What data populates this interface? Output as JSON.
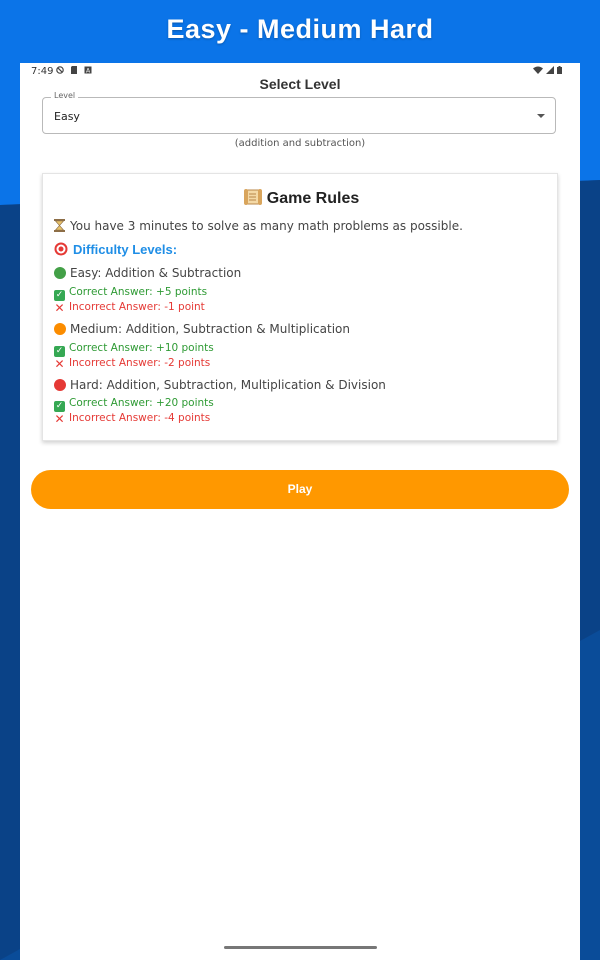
{
  "banner": {
    "title": "Easy - Medium Hard"
  },
  "status_bar": {
    "time": "7:49"
  },
  "page": {
    "heading": "Select Level"
  },
  "level_select": {
    "label": "Level",
    "value": "Easy",
    "helper": "(addition and subtraction)"
  },
  "rules": {
    "title": "Game Rules",
    "timer_text": "You have 3 minutes to solve as many math problems as possible.",
    "difficulty_heading": "Difficulty Levels:",
    "levels": [
      {
        "name": "Easy: Addition & Subtraction",
        "correct": "Correct Answer: +5 points",
        "incorrect": "Incorrect Answer: -1 point"
      },
      {
        "name": "Medium: Addition, Subtraction & Multiplication",
        "correct": "Correct Answer: +10 points",
        "incorrect": "Incorrect Answer: -2 points"
      },
      {
        "name": "Hard: Addition, Subtraction, Multiplication & Division",
        "correct": "Correct Answer: +20 points",
        "incorrect": "Incorrect Answer: -4 points"
      }
    ]
  },
  "play_button": {
    "label": "Play"
  },
  "colors": {
    "background": "#0b74e8",
    "accent_orange": "#ff9800",
    "heading_blue": "#1f8ee6",
    "correct_green": "#2e9a34",
    "incorrect_red": "#e53935"
  },
  "icons": {
    "title": "scroll-icon",
    "timer": "hourglass-icon",
    "difficulty": "target-icon",
    "easy": "green-circle-icon",
    "medium": "orange-circle-icon",
    "hard": "red-circle-icon",
    "correct": "check-mark-icon",
    "incorrect": "cross-mark-icon"
  }
}
